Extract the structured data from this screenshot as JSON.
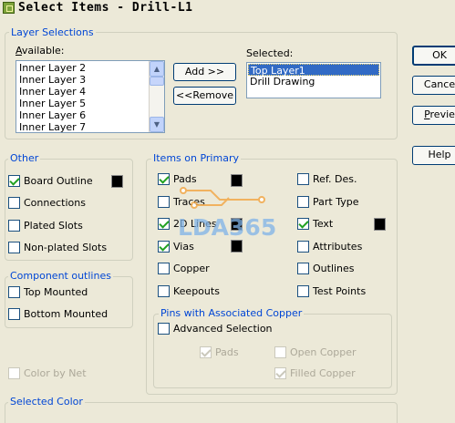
{
  "window": {
    "title": "Select Items - Drill-L1"
  },
  "layer_selections": {
    "legend": "Layer Selections",
    "available_label": "Available:",
    "available_items": [
      "Inner Layer 2",
      "Inner Layer 3",
      "Inner Layer 4",
      "Inner Layer 5",
      "Inner Layer 6",
      "Inner Layer 7"
    ],
    "selected_label": "Selected:",
    "selected_items": [
      "Top Layer1",
      "Drill Drawing"
    ],
    "add_label": "Add >>",
    "remove_label": "<<Remove"
  },
  "dialog_buttons": {
    "ok": "OK",
    "cancel": "Cance",
    "preview": "Previe",
    "help": "Help"
  },
  "other": {
    "legend": "Other",
    "items": [
      {
        "label": "Board Outline",
        "checked": true
      },
      {
        "label": "Connections",
        "checked": false
      },
      {
        "label": "Plated Slots",
        "checked": false
      },
      {
        "label": "Non-plated Slots",
        "checked": false
      }
    ]
  },
  "component_outlines": {
    "legend": "Component outlines",
    "items": [
      {
        "label": "Top Mounted",
        "checked": false
      },
      {
        "label": "Bottom Mounted",
        "checked": false
      }
    ]
  },
  "color_by_net": {
    "label": "Color by Net",
    "checked": false,
    "enabled": false
  },
  "items_on_primary": {
    "legend": "Items on Primary",
    "left": [
      {
        "label": "Pads",
        "checked": true
      },
      {
        "label": "Traces",
        "checked": false
      },
      {
        "label": "2D Lines",
        "checked": true
      },
      {
        "label": "Vias",
        "checked": true
      },
      {
        "label": "Copper",
        "checked": false
      },
      {
        "label": "Keepouts",
        "checked": false
      }
    ],
    "right": [
      {
        "label": "Ref. Des.",
        "checked": false
      },
      {
        "label": "Part Type",
        "checked": false
      },
      {
        "label": "Text",
        "checked": true
      },
      {
        "label": "Attributes",
        "checked": false
      },
      {
        "label": "Outlines",
        "checked": false
      },
      {
        "label": "Test Points",
        "checked": false
      }
    ]
  },
  "pins_with_copper": {
    "legend": "Pins with Associated Copper",
    "advanced": {
      "label": "Advanced Selection",
      "checked": false
    },
    "pads": {
      "label": "Pads",
      "checked": true,
      "enabled": false
    },
    "open_copper": {
      "label": "Open Copper",
      "checked": false,
      "enabled": false
    },
    "filled_copper": {
      "label": "Filled Copper",
      "checked": true,
      "enabled": false
    }
  },
  "selected_color": {
    "legend": "Selected Color"
  },
  "watermark": {
    "text": "LDA365"
  },
  "colors": {
    "swatch": "#000000",
    "legend_text": "#0046d5",
    "selection": "#316ac5",
    "watermark": "#7fb3e8"
  }
}
